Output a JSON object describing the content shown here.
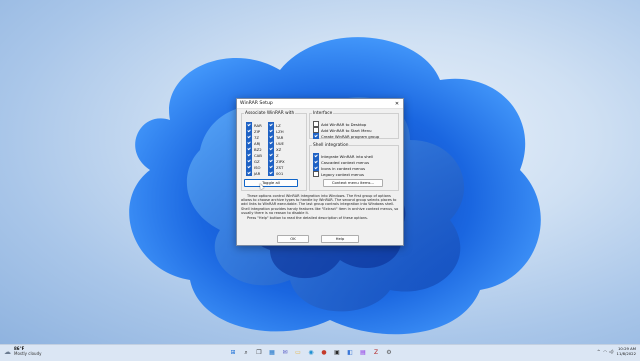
{
  "dialog": {
    "title": "WinRAR Setup",
    "close_glyph": "✕",
    "associate": {
      "legend": "Associate WinRAR with",
      "col1": [
        {
          "label": "RAR",
          "checked": true
        },
        {
          "label": "ZIP",
          "checked": true
        },
        {
          "label": "7Z",
          "checked": true
        },
        {
          "label": "ARJ",
          "checked": true
        },
        {
          "label": "BZ2",
          "checked": true
        },
        {
          "label": "CAB",
          "checked": true
        },
        {
          "label": "GZ",
          "checked": true
        },
        {
          "label": "ISO",
          "checked": true
        },
        {
          "label": "JAR",
          "checked": true
        }
      ],
      "col2": [
        {
          "label": "LZ",
          "checked": true
        },
        {
          "label": "LZH",
          "checked": true
        },
        {
          "label": "TAR",
          "checked": true
        },
        {
          "label": "UUE",
          "checked": true
        },
        {
          "label": "XZ",
          "checked": true
        },
        {
          "label": "Z",
          "checked": true
        },
        {
          "label": "ZIPX",
          "checked": true
        },
        {
          "label": "ZST",
          "checked": true
        },
        {
          "label": "001",
          "checked": true
        }
      ],
      "toggle_label": "Toggle all"
    },
    "interface": {
      "legend": "Interface",
      "items": [
        {
          "label": "Add WinRAR to Desktop",
          "checked": false
        },
        {
          "label": "Add WinRAR to Start Menu",
          "checked": false
        },
        {
          "label": "Create WinRAR program group",
          "checked": true
        }
      ]
    },
    "shell": {
      "legend": "Shell integration",
      "items": [
        {
          "label": "Integrate WinRAR into shell",
          "checked": true
        },
        {
          "label": "Cascaded context menus",
          "checked": true
        },
        {
          "label": "Icons in context menus",
          "checked": true
        },
        {
          "label": "Legacy context menus",
          "checked": false
        }
      ],
      "context_button": "Context menu items..."
    },
    "description": [
      "These options control WinRAR integration into Windows. The first group of options allows to choose archive types to handle by WinRAR. The second group selects places to add links to WinRAR executable. The last group controls integration into Windows shell. Shell integration provides handy features like \"Extract\" item in archive context menus, so usually there is no reason to disable it.",
      "Press \"Help\" button to read the detailed description of these options."
    ],
    "ok_label": "OK",
    "help_label": "Help"
  },
  "taskbar": {
    "weather_temp": "86°F",
    "weather_desc": "Mostly cloudy",
    "apps": [
      {
        "icon": "windows-icon",
        "glyph": "⊞",
        "color": "#1a6fd6"
      },
      {
        "icon": "search-icon",
        "glyph": "⌕",
        "color": "#333333"
      },
      {
        "icon": "task-view-icon",
        "glyph": "❐",
        "color": "#333333"
      },
      {
        "icon": "widgets-icon",
        "glyph": "▦",
        "color": "#1a73c9"
      },
      {
        "icon": "chat-icon",
        "glyph": "✉",
        "color": "#5b5fc7"
      },
      {
        "icon": "file-explorer-icon",
        "glyph": "▭",
        "color": "#e8b43a"
      },
      {
        "icon": "edge-icon",
        "glyph": "◉",
        "color": "#1c8fd1"
      },
      {
        "icon": "media-icon",
        "glyph": "●",
        "color": "#c43a2b"
      },
      {
        "icon": "terminal-icon",
        "glyph": "▣",
        "color": "#2b2b2b"
      },
      {
        "icon": "store-icon",
        "glyph": "◧",
        "color": "#3c78d8"
      },
      {
        "icon": "winrar-icon",
        "glyph": "▤",
        "color": "#8a2be2"
      },
      {
        "icon": "filezilla-icon",
        "glyph": "Z",
        "color": "#b22222"
      },
      {
        "icon": "settings-icon",
        "glyph": "⚙",
        "color": "#555555"
      }
    ],
    "tray_up": "^",
    "tray_wifi": "◠",
    "tray_volume": "◁)",
    "time": "10:29 AM",
    "date": "11/8/2022"
  }
}
